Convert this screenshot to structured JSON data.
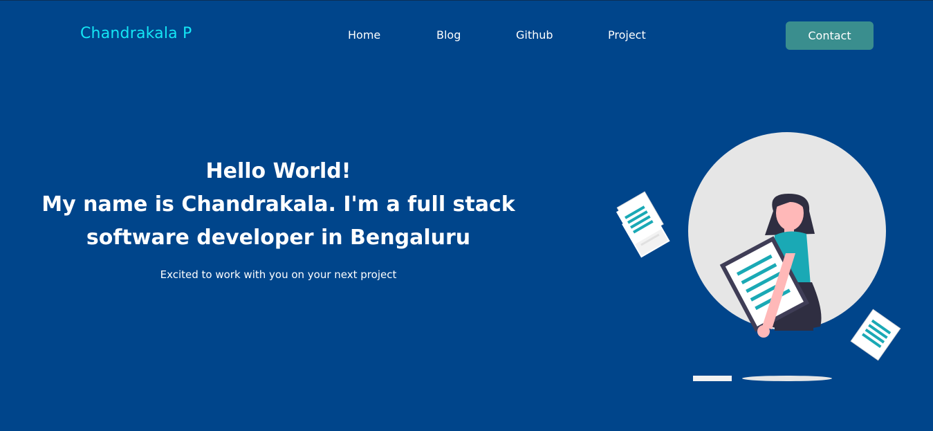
{
  "nav": {
    "brand": "Chandrakala P",
    "links": [
      {
        "label": "Home"
      },
      {
        "label": "Blog"
      },
      {
        "label": "Github"
      },
      {
        "label": "Project"
      }
    ],
    "contact_label": "Contact"
  },
  "hero": {
    "line1": "Hello World!",
    "line2": "My name is Chandrakala. I'm a full stack",
    "line3": "software developer in Bengaluru",
    "subtitle": "Excited to work with you on your next project"
  },
  "illustration": {
    "icon": "woman-holding-document-illustration"
  },
  "colors": {
    "background": "#00458b",
    "brand": "#14e6f5",
    "button": "#3a8e8e",
    "accent": "#1aa9b5"
  }
}
